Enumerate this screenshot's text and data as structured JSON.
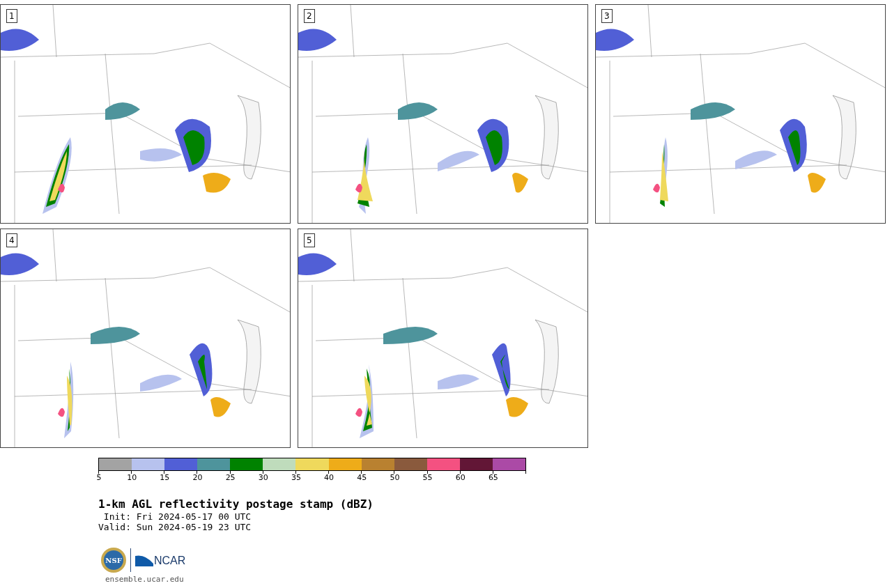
{
  "panels": [
    {
      "label": "1"
    },
    {
      "label": "2"
    },
    {
      "label": "3"
    },
    {
      "label": "4"
    },
    {
      "label": "5"
    }
  ],
  "colorbar": {
    "bins": [
      {
        "color": "#a3a3a3",
        "tick": "5"
      },
      {
        "color": "#b7c2ee",
        "tick": "10"
      },
      {
        "color": "#515fd6",
        "tick": "15"
      },
      {
        "color": "#4e949c",
        "tick": "20"
      },
      {
        "color": "#008200",
        "tick": "25"
      },
      {
        "color": "#bfdcbc",
        "tick": "30"
      },
      {
        "color": "#efd95c",
        "tick": "35"
      },
      {
        "color": "#eeac19",
        "tick": "40"
      },
      {
        "color": "#b98130",
        "tick": "45"
      },
      {
        "color": "#8a5a3d",
        "tick": "50"
      },
      {
        "color": "#f45181",
        "tick": "55"
      },
      {
        "color": "#621636",
        "tick": "60"
      },
      {
        "color": "#ab4aa6",
        "tick": "65"
      }
    ]
  },
  "title": "1-km AGL reflectivity postage stamp (dBZ)",
  "init": " Init: Fri 2024-05-17 00 UTC",
  "valid": "Valid: Sun 2024-05-19 23 UTC",
  "logo": {
    "seal": "NSF",
    "wordmark": "NCAR"
  },
  "url": "ensemble.ucar.edu"
}
